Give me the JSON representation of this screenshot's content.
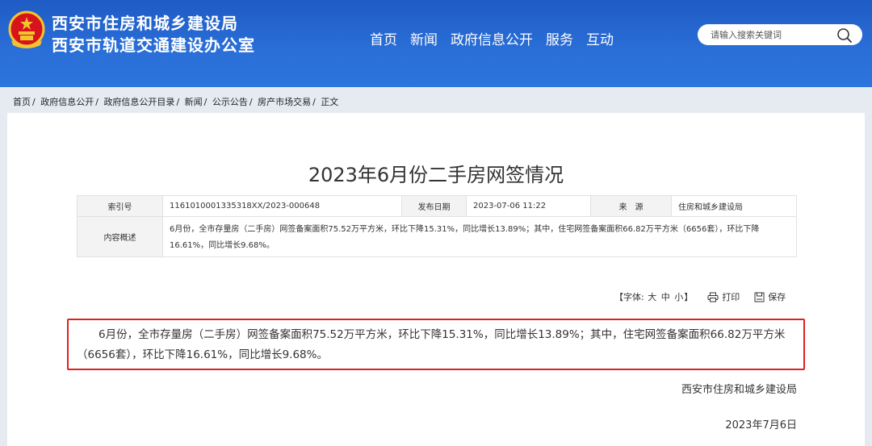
{
  "header": {
    "org_name_1": "西安市住房和城乡建设局",
    "org_name_2": "西安市轨道交通建设办公室",
    "emblem_icon": "national-emblem-icon",
    "color_primary": "#2a6fd8",
    "nav": [
      {
        "label": "首页"
      },
      {
        "label": "新闻"
      },
      {
        "label": "政府信息公开"
      },
      {
        "label": "服务"
      },
      {
        "label": "互动"
      }
    ],
    "search": {
      "placeholder": "请输入搜索关键词",
      "icon": "search-icon"
    }
  },
  "breadcrumb": [
    "首页",
    "政府信息公开",
    "政府信息公开目录",
    "新闻",
    "公示公告",
    "房产市场交易",
    "正文"
  ],
  "article": {
    "title": "2023年6月份二手房网签情况",
    "meta": {
      "index_label": "索引号",
      "index_value": "1161010001335318XX/2023-000648",
      "date_label": "发布日期",
      "date_value": "2023-07-06 11:22",
      "source_label": "来　源",
      "source_value": "住房和城乡建设局",
      "summary_label": "内容概述",
      "summary_value": "6月份，全市存量房（二手房）网签备案面积75.52万平方米，环比下降15.31%，同比增长13.89%；其中，住宅网签备案面积66.82万平方米（6656套），环比下降16.61%，同比增长9.68%。"
    },
    "tools": {
      "font_label": "【字体:",
      "font_large": "大",
      "font_medium": "中",
      "font_small": "小",
      "font_close": "】",
      "print_label": "打印",
      "print_icon": "printer-icon",
      "save_label": "保存",
      "save_icon": "save-icon"
    },
    "body": "6月份，全市存量房（二手房）网签备案面积75.52万平方米，环比下降15.31%，同比增长13.89%；其中，住宅网签备案面积66.82万平方米（6656套），环比下降16.61%，同比增长9.68%。",
    "highlight_color": "#e02020",
    "signature": "西安市住房和城乡建设局",
    "sign_date": "2023年7月6日"
  }
}
